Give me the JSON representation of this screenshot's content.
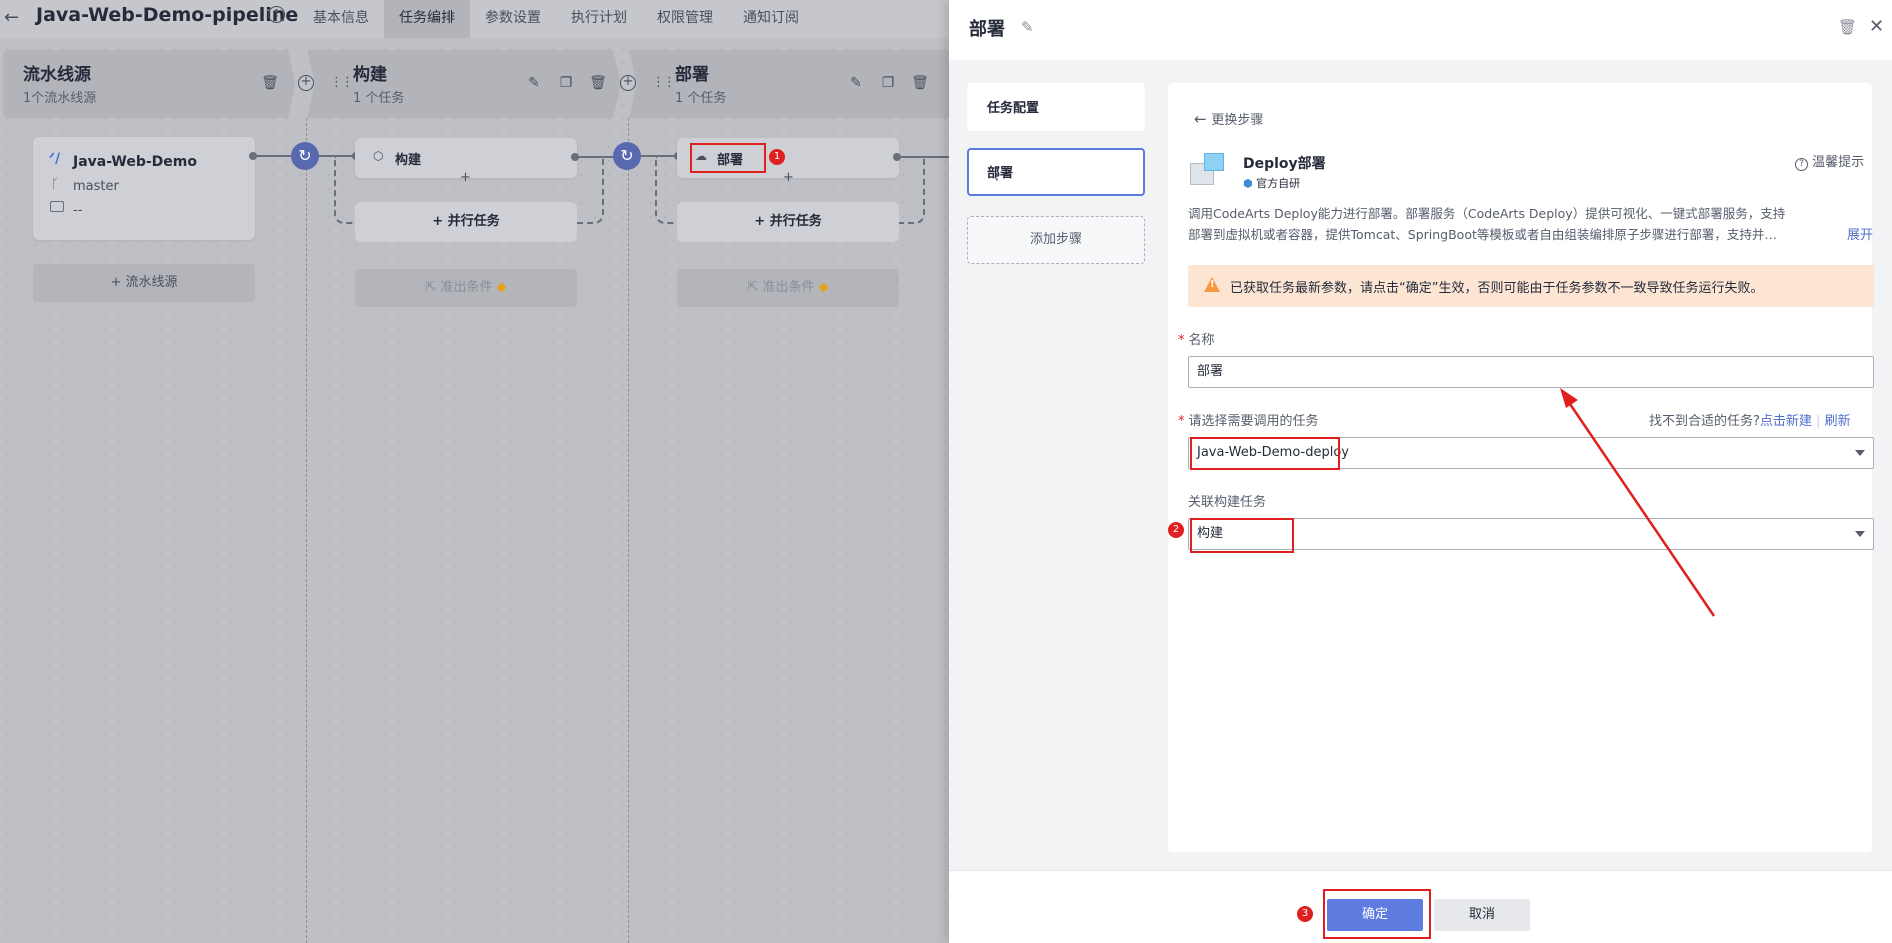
{
  "header": {
    "back_icon": "arrow-left-icon",
    "pipeline_name": "Java-Web-Demo-pipeline",
    "tabs": [
      "基本信息",
      "任务编排",
      "参数设置",
      "执行计划",
      "权限管理",
      "通知订阅"
    ],
    "active_tab": "任务编排"
  },
  "stages": [
    {
      "title": "流水线源",
      "subtitle": "1个流水线源"
    },
    {
      "title": "构建",
      "subtitle": "1 个任务"
    },
    {
      "title": "部署",
      "subtitle": "1 个任务"
    }
  ],
  "source_card": {
    "name": "Java-Web-Demo",
    "branch": "master",
    "extra": "--",
    "add_source_label": "+ 流水线源"
  },
  "build_stage": {
    "job_label": "构建",
    "parallel_label": "+ 并行任务",
    "exit_condition_label": "准出条件"
  },
  "deploy_stage": {
    "job_label": "部署",
    "parallel_label": "+ 并行任务",
    "exit_condition_label": "准出条件"
  },
  "annotations": {
    "badge1": "1",
    "badge2": "2",
    "badge3": "3"
  },
  "panel": {
    "title": "部署",
    "steps": {
      "task_config": "任务配置",
      "deploy": "部署",
      "add_step": "添加步骤"
    },
    "change_step": "更换步骤",
    "plugin": {
      "name": "Deploy部署",
      "vendor": "官方自研",
      "tips": "温馨提示",
      "description_line1": "调用CodeArts Deploy能力进行部署。部署服务（CodeArts Deploy）提供可视化、一键式部署服务，支持",
      "description_line2": "部署到虚拟机或者容器，提供Tomcat、SpringBoot等模板或者自由组装编排原子步骤进行部署，支持并…",
      "expand": "展开"
    },
    "warning": "已获取任务最新参数，请点击“确定”生效，否则可能由于任务参数不一致导致任务运行失败。",
    "fields": {
      "name_label": "名称",
      "name_value": "部署",
      "task_label": "请选择需要调用的任务",
      "not_found": "找不到合适的任务?",
      "create_new": "点击新建",
      "refresh": "刷新",
      "task_value": "Java-Web-Demo-deploy",
      "related_label": "关联构建任务",
      "related_value": "构建"
    },
    "footer": {
      "ok": "确定",
      "cancel": "取消"
    }
  },
  "colors": {
    "primary": "#5e7ce0",
    "annotation_red": "#e02020",
    "warning_bg": "#fde5d4",
    "warning_icon": "#fa9841"
  }
}
